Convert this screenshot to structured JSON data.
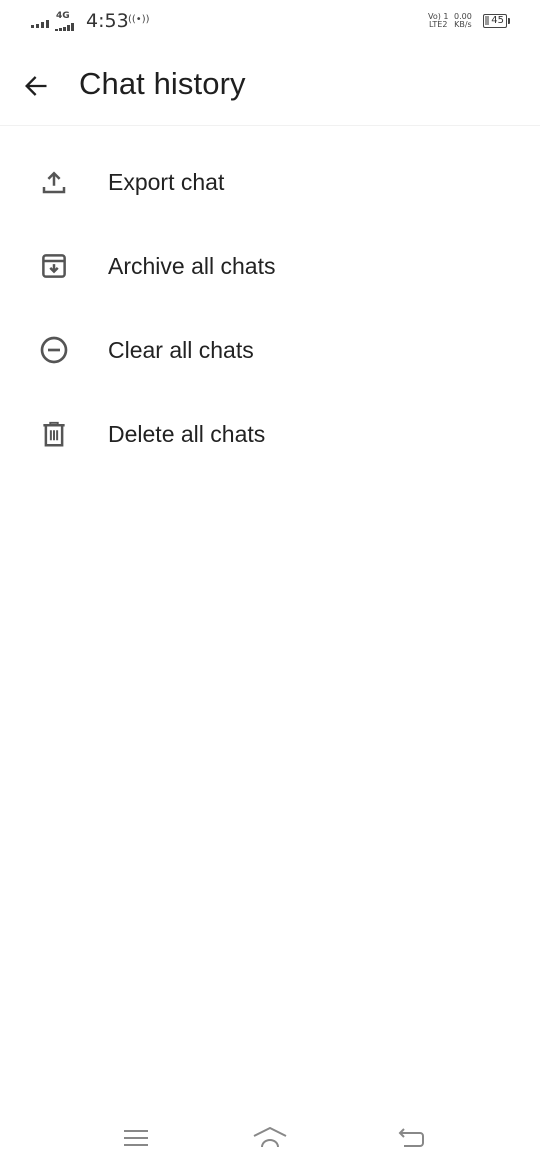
{
  "status_bar": {
    "network_type": "4G",
    "time": "4:53",
    "hotspot": "((•))",
    "volte_line1": "Vo) 1",
    "volte_line2": "LTE2",
    "speed_value": "0.00",
    "speed_unit": "KB/s",
    "battery": "45"
  },
  "app_bar": {
    "title": "Chat history",
    "back_icon": "arrow-left-icon"
  },
  "menu": {
    "items": [
      {
        "label": "Export chat",
        "icon": "upload-icon"
      },
      {
        "label": "Archive all chats",
        "icon": "archive-icon"
      },
      {
        "label": "Clear all chats",
        "icon": "minus-circle-icon"
      },
      {
        "label": "Delete all chats",
        "icon": "trash-icon"
      }
    ]
  },
  "nav_bar": {
    "icons": [
      "menu-icon",
      "home-icon",
      "back-icon"
    ]
  },
  "colors": {
    "text": "#1f1f1f",
    "icon": "#555555",
    "background": "#ffffff"
  }
}
